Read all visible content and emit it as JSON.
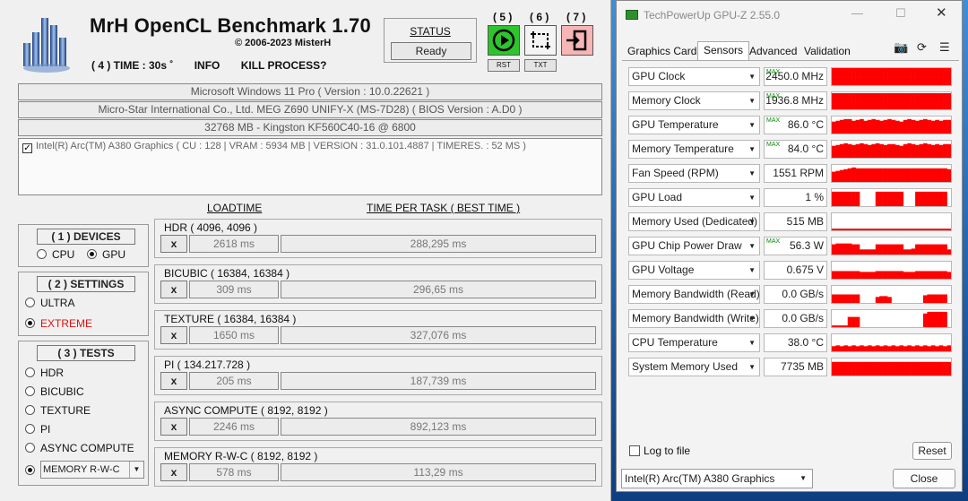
{
  "mrh": {
    "title": "MrH OpenCL Benchmark 1.70",
    "copyright": "©  2006-2023 MisterH",
    "time": "( 4 ) TIME : 30s ˚",
    "info": "INFO",
    "kill": "KILL PROCESS?",
    "status_label": "STATUS",
    "status_value": "Ready",
    "btn5_num": "( 5 )",
    "btn6_num": "( 6 )",
    "btn7_num": "( 7 )",
    "rst": "RST",
    "txt": "TXT",
    "os": "Microsoft Windows 11 Pro ( Version : 10.0.22621 )",
    "board": "Micro-Star International Co., Ltd. MEG Z690 UNIFY-X (MS-7D28) ( BIOS Version : A.D0 )",
    "memory": "32768 MB - Kingston KF560C40-16          @ 6800",
    "gpu_item": "Intel(R) Arc(TM) A380 Graphics ( CU : 128 | VRAM : 5934 MB | VERSION : 31.0.101.4887 | TIMERES. : 52 MS )",
    "gpu_check": "✓",
    "col_loadtime": "LOADTIME",
    "col_tpt": "TIME PER TASK ( BEST TIME )",
    "devices": {
      "title": "( 1 ) DEVICES",
      "cpu": "CPU",
      "gpu": "GPU"
    },
    "settings": {
      "title": "( 2 ) SETTINGS",
      "ultra": "ULTRA",
      "extreme": "EXTREME",
      "extreme_color": "#e01010"
    },
    "tests": {
      "title": "( 3 ) TESTS",
      "items": [
        "HDR",
        "BICUBIC",
        "TEXTURE",
        "PI",
        "ASYNC COMPUTE"
      ],
      "selected": "MEMORY R-W-C"
    },
    "results": [
      {
        "name": "HDR ( 4096, 4096 )",
        "x": "x",
        "load": "2618 ms",
        "tpt": "288,295 ms"
      },
      {
        "name": "BICUBIC ( 16384, 16384 )",
        "x": "x",
        "load": "309 ms",
        "tpt": "296,65 ms"
      },
      {
        "name": "TEXTURE ( 16384, 16384 )",
        "x": "x",
        "load": "1650 ms",
        "tpt": "327,076 ms"
      },
      {
        "name": "PI ( 134.217.728 )",
        "x": "x",
        "load": "205 ms",
        "tpt": "187,739 ms"
      },
      {
        "name": "ASYNC COMPUTE ( 8192, 8192 )",
        "x": "x",
        "load": "2246 ms",
        "tpt": "892,123 ms"
      },
      {
        "name": "MEMORY R-W-C ( 8192, 8192 )",
        "x": "x",
        "load": "578 ms",
        "tpt": "113,29 ms"
      }
    ]
  },
  "gpuz": {
    "title": "TechPowerUp GPU-Z 2.55.0",
    "tabs": [
      "Graphics Card",
      "Sensors",
      "Advanced",
      "Validation"
    ],
    "active_tab": "Sensors",
    "graph_color": "#ff0000",
    "sensors": [
      {
        "name": "GPU Clock",
        "value": "2450.0 MHz",
        "max": "MAX"
      },
      {
        "name": "Memory Clock",
        "value": "1936.8 MHz",
        "max": "MAX"
      },
      {
        "name": "GPU Temperature",
        "value": "86.0 °C",
        "max": "MAX"
      },
      {
        "name": "Memory Temperature",
        "value": "84.0 °C",
        "max": "MAX"
      },
      {
        "name": "Fan Speed (RPM)",
        "value": "1551 RPM",
        "max": ""
      },
      {
        "name": "GPU Load",
        "value": "1 %",
        "max": ""
      },
      {
        "name": "Memory Used (Dedicated)",
        "value": "515 MB",
        "max": ""
      },
      {
        "name": "GPU Chip Power Draw",
        "value": "56.3 W",
        "max": "MAX"
      },
      {
        "name": "GPU Voltage",
        "value": "0.675 V",
        "max": ""
      },
      {
        "name": "Memory Bandwidth (Read)",
        "value": "0.0 GB/s",
        "max": ""
      },
      {
        "name": "Memory Bandwidth (Write)",
        "value": "0.0 GB/s",
        "max": ""
      },
      {
        "name": "CPU Temperature",
        "value": "38.0 °C",
        "max": ""
      },
      {
        "name": "System Memory Used",
        "value": "7735 MB",
        "max": ""
      }
    ],
    "log_to_file": "Log to file",
    "reset": "Reset",
    "device": "Intel(R) Arc(TM) A380 Graphics",
    "close": "Close"
  }
}
